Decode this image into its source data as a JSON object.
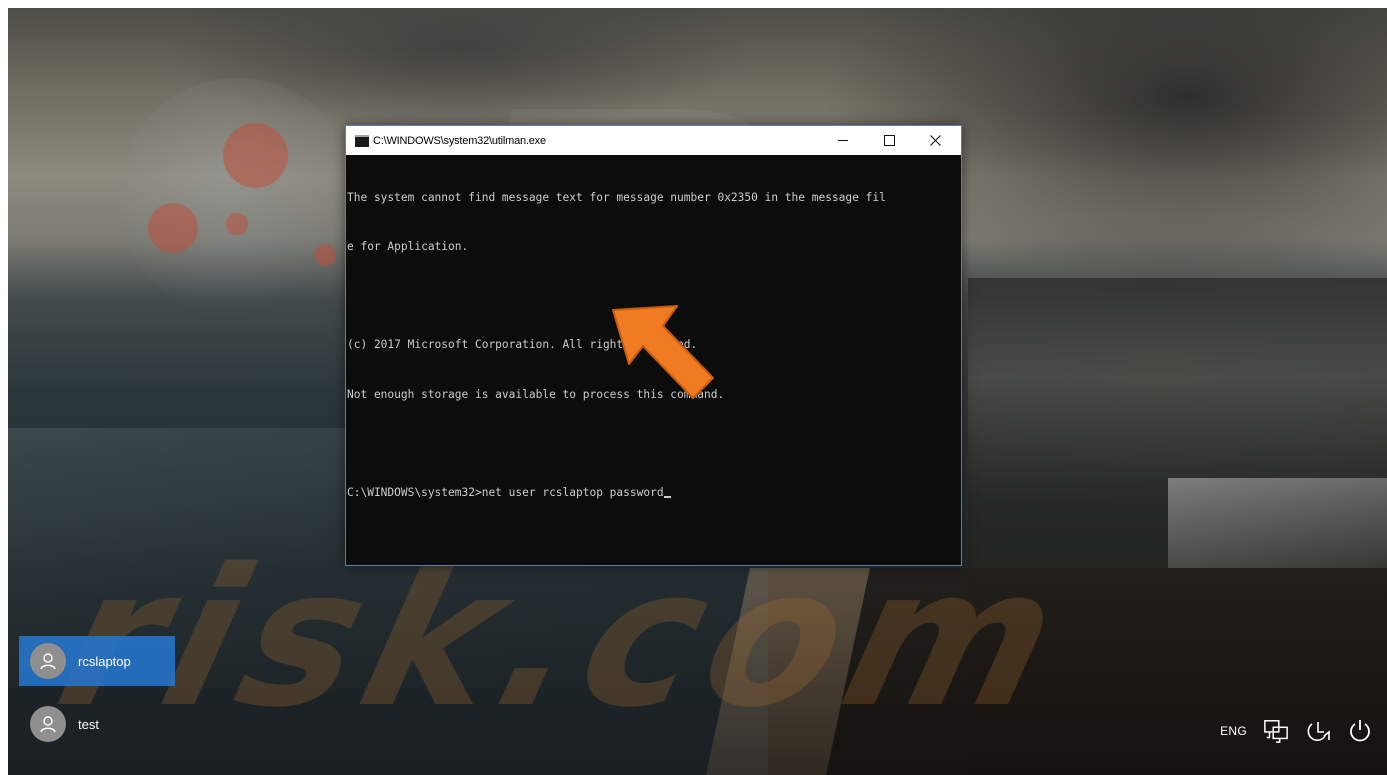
{
  "console": {
    "title": "C:\\WINDOWS\\system32\\utilman.exe",
    "lines": [
      "The system cannot find message text for message number 0x2350 in the message fil",
      "e for Application.",
      "",
      "(c) 2017 Microsoft Corporation. All rights reserved.",
      "Not enough storage is available to process this command.",
      "",
      "C:\\WINDOWS\\system32>net user rcslaptop password"
    ]
  },
  "watermark": "risk.com",
  "users": [
    {
      "name": "rcslaptop",
      "selected": true
    },
    {
      "name": "test",
      "selected": false
    }
  ],
  "tray": {
    "language": "ENG",
    "icons": [
      "network-icon",
      "ease-of-access-icon",
      "power-icon"
    ]
  },
  "colors": {
    "selected_user": "#2678d2",
    "console_bg": "#0c0c0c",
    "console_text": "#cccccc",
    "arrow": "#f07b22"
  }
}
